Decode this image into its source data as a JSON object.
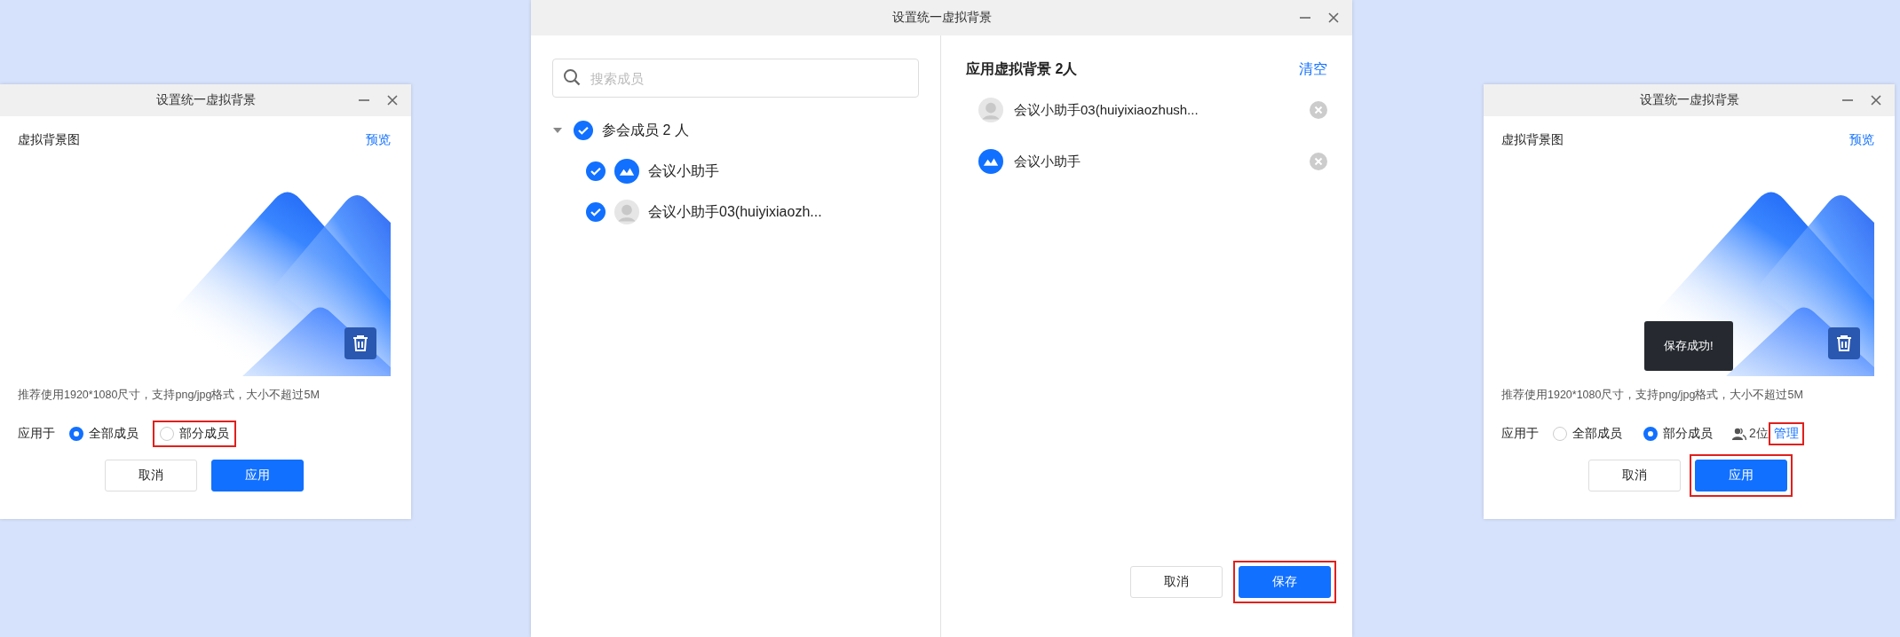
{
  "settings_dialogs": [
    {
      "title": "设置统一虚拟背景",
      "section_label": "虚拟背景图",
      "preview_link": "预览",
      "hint": "推荐使用1920*1080尺寸，支持png/jpg格式，大小不超过5M",
      "apply_label": "应用于",
      "options": [
        {
          "label": "全部成员",
          "selected": true,
          "highlighted": false
        },
        {
          "label": "部分成员",
          "selected": false,
          "highlighted": true
        }
      ],
      "buttons": [
        {
          "label": "取消",
          "kind": "secondary",
          "highlighted": false
        },
        {
          "label": "应用",
          "kind": "primary",
          "highlighted": false
        }
      ]
    },
    {
      "title": "设置统一虚拟背景",
      "section_label": "虚拟背景图",
      "preview_link": "预览",
      "hint": "推荐使用1920*1080尺寸，支持png/jpg格式，大小不超过5M",
      "apply_label": "应用于",
      "toast": "保存成功!",
      "options": [
        {
          "label": "全部成员",
          "selected": false,
          "highlighted": false
        },
        {
          "label": "部分成员",
          "selected": true,
          "highlighted": false
        }
      ],
      "member_count": "2位",
      "manage_link": {
        "label": "管理",
        "highlighted": true
      },
      "buttons": [
        {
          "label": "取消",
          "kind": "secondary",
          "highlighted": false
        },
        {
          "label": "应用",
          "kind": "primary",
          "highlighted": true
        }
      ]
    }
  ],
  "member_dialog": {
    "title": "设置统一虚拟背景",
    "search": {
      "placeholder": "搜索成员"
    },
    "tree": {
      "label": "参会成员 2 人",
      "checked": true,
      "expanded": true,
      "children": [
        {
          "label": "会议小助手",
          "checked": true,
          "kind": "app"
        },
        {
          "label": "会议小助手03(huiyixiaozh...",
          "checked": true,
          "kind": "person"
        }
      ]
    },
    "selected_title": "应用虚拟背景 2人",
    "clear_link": "清空",
    "selected_members": [
      {
        "label": "会议小助手03(huiyixiaozhush...",
        "kind": "person"
      },
      {
        "label": "会议小助手",
        "kind": "app"
      }
    ],
    "buttons": [
      {
        "label": "取消",
        "kind": "secondary",
        "highlighted": false
      },
      {
        "label": "保存",
        "kind": "primary",
        "highlighted": true
      }
    ]
  }
}
